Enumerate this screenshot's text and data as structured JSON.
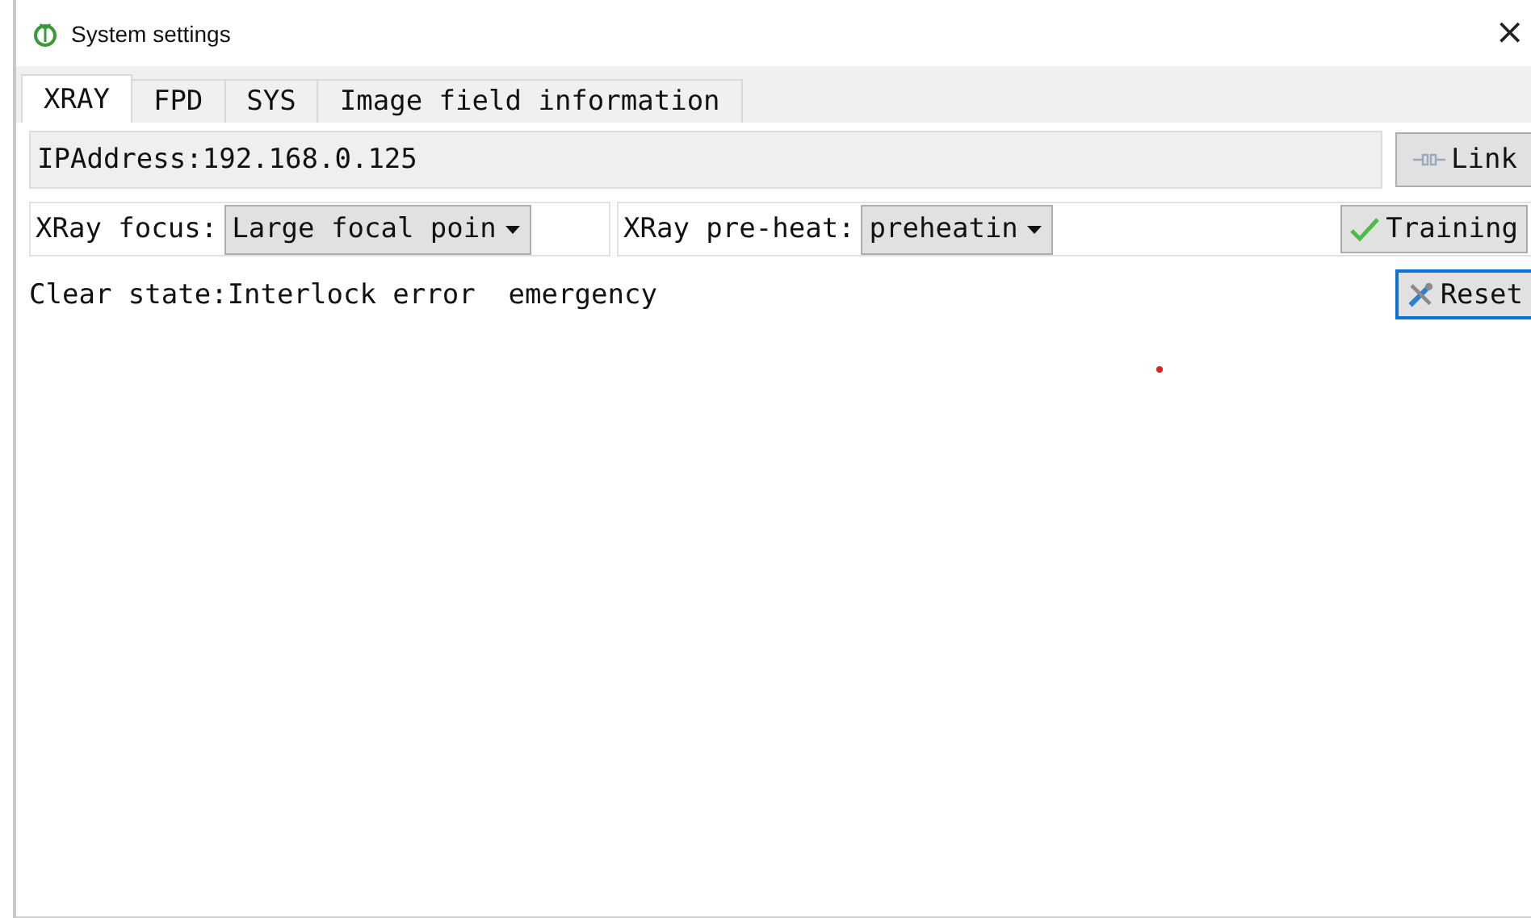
{
  "window": {
    "title": "System settings",
    "close": "×"
  },
  "tabs": [
    {
      "label": "XRAY",
      "selected": true
    },
    {
      "label": "FPD",
      "selected": false
    },
    {
      "label": "SYS",
      "selected": false
    },
    {
      "label": "Image field information",
      "selected": false
    }
  ],
  "ip_field": {
    "value": "IPAddress:192.168.0.125"
  },
  "link_button": {
    "label": "Link"
  },
  "focus": {
    "label": "XRay focus:",
    "value": "Large focal poin"
  },
  "preheat": {
    "label": "XRay pre-heat:",
    "value": "preheatin"
  },
  "training_button": {
    "label": "Training"
  },
  "clear_state": "Clear state:Interlock error  emergency",
  "reset_button": {
    "label": "Reset",
    "focused": true
  }
}
